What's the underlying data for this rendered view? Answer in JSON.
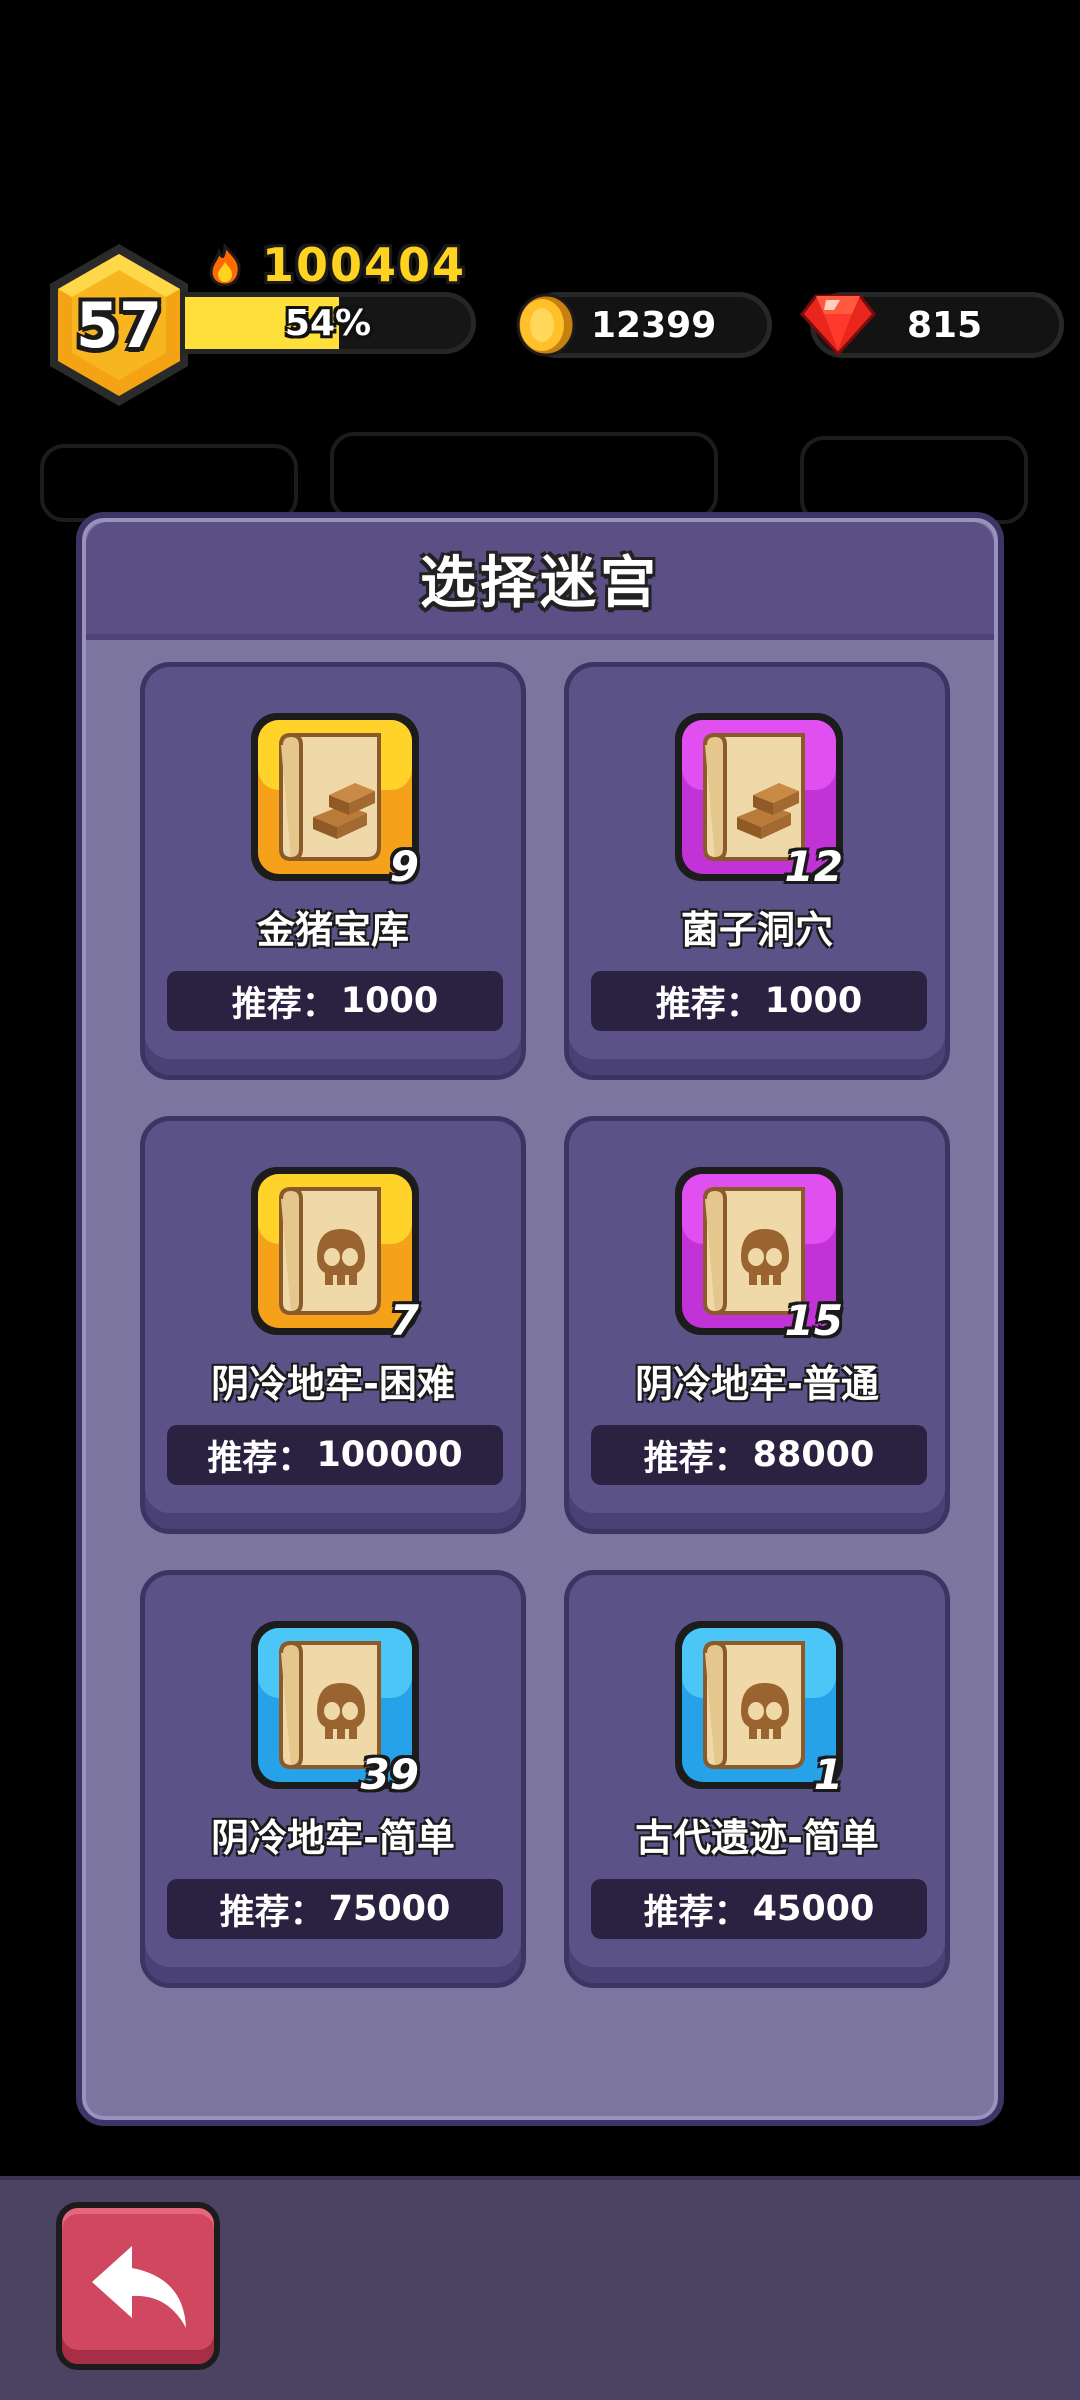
{
  "hud": {
    "level": "57",
    "power": "100404",
    "xp_label": "54%",
    "xp_fraction": 0.54,
    "coins": "12399",
    "gems": "815",
    "icons": [
      "fire-icon",
      "coin-icon",
      "gem-icon"
    ]
  },
  "modal": {
    "title": "选择迷宫",
    "rec_label": "推荐：",
    "cards": [
      {
        "name": "金猪宝库",
        "count": "9",
        "recommend": "1000",
        "icon": "gold-bars-map-icon",
        "color": "#f5a21a"
      },
      {
        "name": "菌子洞穴",
        "count": "12",
        "recommend": "1000",
        "icon": "gold-bars-map-icon",
        "color": "#c133d6"
      },
      {
        "name": "阴冷地牢-困难",
        "count": "7",
        "recommend": "100000",
        "icon": "skull-map-icon",
        "color": "#f5a21a"
      },
      {
        "name": "阴冷地牢-普通",
        "count": "15",
        "recommend": "88000",
        "icon": "skull-map-icon",
        "color": "#c133d6"
      },
      {
        "name": "阴冷地牢-简单",
        "count": "39",
        "recommend": "75000",
        "icon": "skull-map-icon",
        "color": "#25a2e8"
      },
      {
        "name": "古代遗迹-简单",
        "count": "1",
        "recommend": "45000",
        "icon": "skull-map-icon",
        "color": "#25a2e8"
      }
    ]
  },
  "colors": {
    "accent_gold": "#ffd31f",
    "panel": "#7b759f",
    "card": "#5b5287",
    "back_button": "#d0485f"
  }
}
